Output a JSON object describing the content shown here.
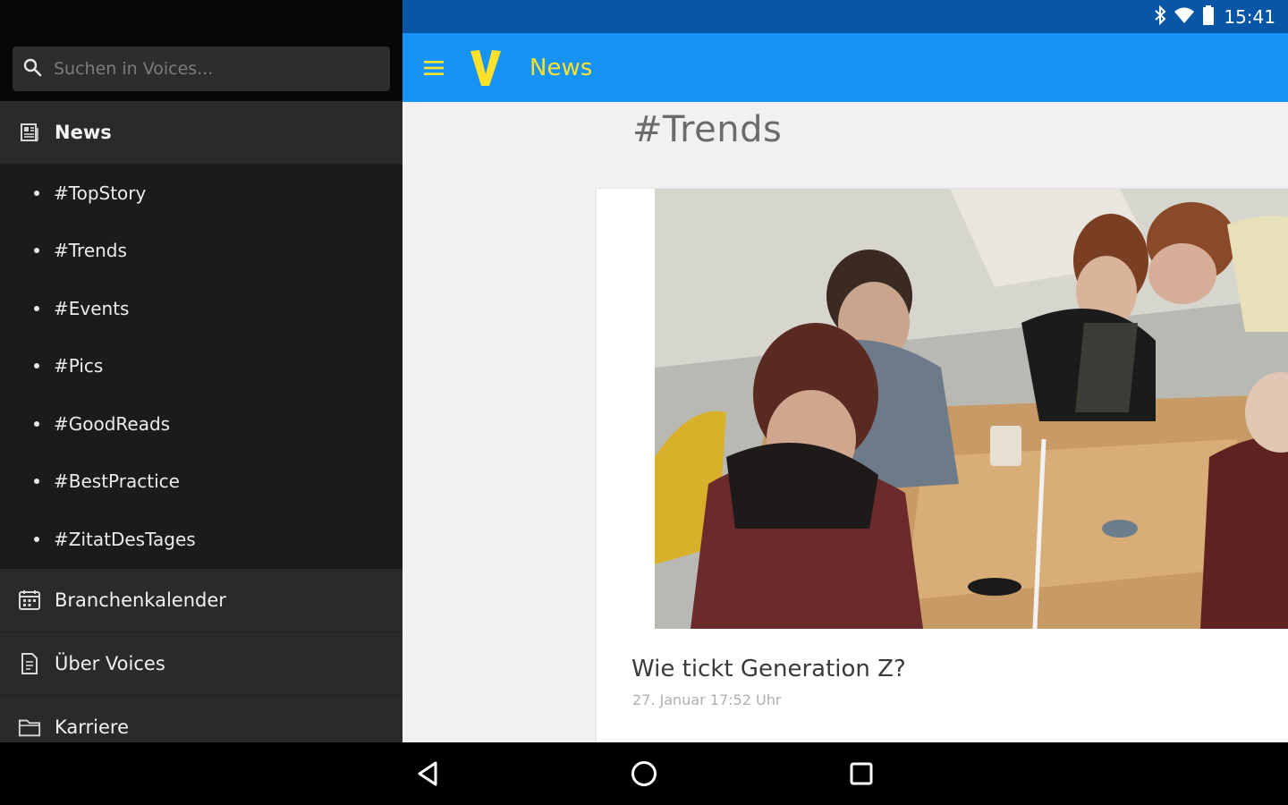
{
  "status_bar": {
    "time": "15:41"
  },
  "drawer": {
    "search_placeholder": "Suchen in Voices...",
    "news_label": "News",
    "sub_items": [
      "#TopStory",
      "#Trends",
      "#Events",
      "#Pics",
      "#GoodReads",
      "#BestPractice",
      "#ZitatDesTages"
    ],
    "calendar_label": "Branchenkalender",
    "about_label": "Über Voices",
    "career_label": "Karriere"
  },
  "appbar": {
    "title": "News",
    "logo_letter": "V"
  },
  "content": {
    "section_heading": "#Trends",
    "article": {
      "title": "Wie tickt Generation Z?",
      "date": "27. Januar 17:52 Uhr"
    }
  },
  "colors": {
    "status_bar": "#0a56a6",
    "app_bar": "#1594f5",
    "accent_yellow": "#ffe12b",
    "drawer_bg": "#1b1b1b"
  },
  "icons": {
    "search": "search-icon",
    "news": "newspaper-icon",
    "calendar": "calendar-icon",
    "about": "document-icon",
    "career": "folder-icon",
    "menu": "hamburger-icon",
    "bluetooth": "bluetooth-icon",
    "wifi": "wifi-icon",
    "battery": "battery-icon",
    "back": "back-icon",
    "home": "home-icon",
    "recents": "recents-icon"
  }
}
